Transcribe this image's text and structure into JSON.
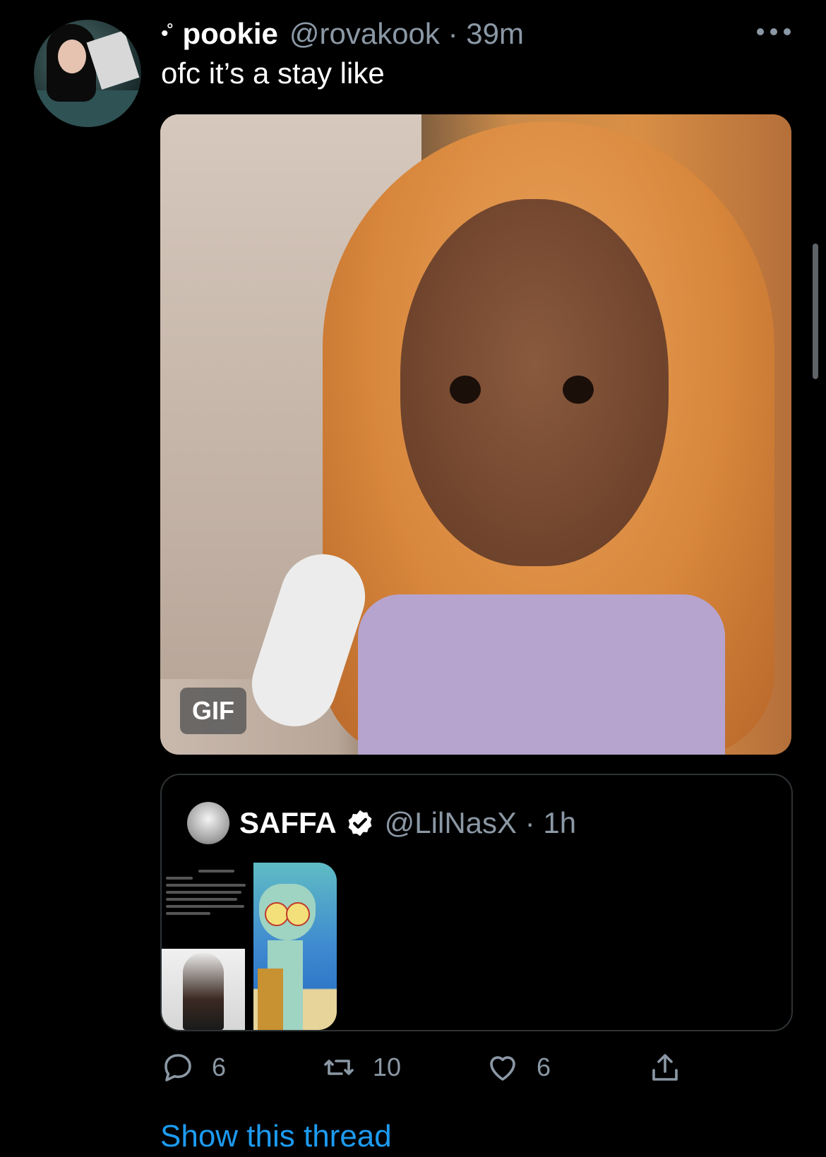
{
  "tweet": {
    "name_prefix": "•˚",
    "name": "pookie",
    "handle_time": "@rovakook · 39m",
    "text": "ofc it’s a stay like",
    "media_badge": "GIF"
  },
  "quoted_tweet": {
    "name": "SAFFA",
    "handle_time": "@LilNasX · 1h"
  },
  "actions": {
    "reply_count": "6",
    "retweet_count": "10",
    "like_count": "6"
  },
  "show_thread": "Show this thread",
  "colors": {
    "background": "#000000",
    "secondary_text": "#8b98a5",
    "link": "#1d9bf0",
    "border": "#2f3336"
  },
  "icons": [
    "more-icon",
    "verified-icon",
    "reply-icon",
    "retweet-icon",
    "like-icon",
    "share-icon"
  ]
}
